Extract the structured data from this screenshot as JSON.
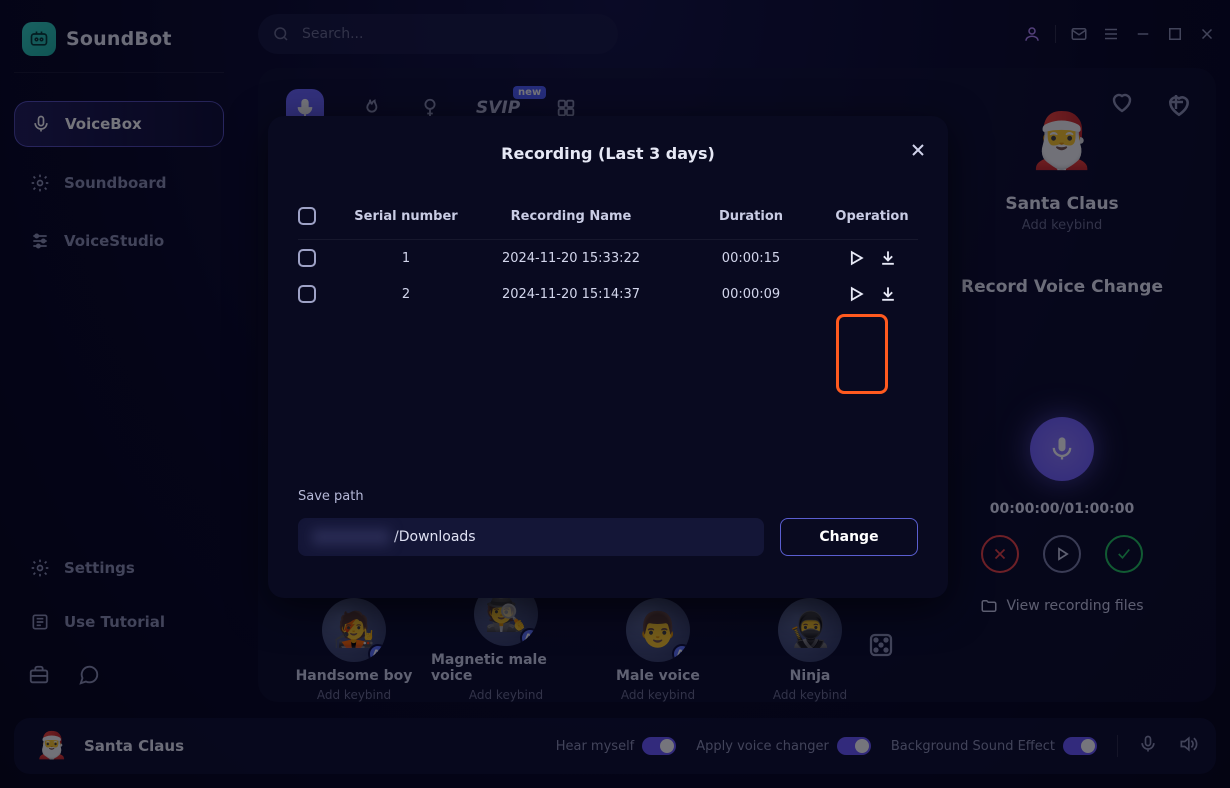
{
  "app": {
    "name": "SoundBot"
  },
  "search": {
    "placeholder": "Search..."
  },
  "sidebar": {
    "items": [
      {
        "label": "VoiceBox"
      },
      {
        "label": "Soundboard"
      },
      {
        "label": "VoiceStudio"
      }
    ],
    "settings_label": "Settings",
    "tutorial_label": "Use Tutorial"
  },
  "tabs": {
    "svip": "SVIP",
    "svip_badge": "new"
  },
  "right": {
    "voice_name": "Santa Claus",
    "voice_sub": "Add keybind",
    "record_label": "Record Voice Change",
    "timer": "00:00:00/01:00:00",
    "view_files": "View recording files"
  },
  "voices": [
    {
      "name": "Handsome boy",
      "sub": "Add keybind",
      "emoji": "🧑‍🎤"
    },
    {
      "name": "Magnetic male voice",
      "sub": "Add keybind",
      "emoji": "🕵️"
    },
    {
      "name": "Male voice",
      "sub": "Add keybind",
      "emoji": "👨"
    },
    {
      "name": "Ninja",
      "sub": "Add keybind",
      "emoji": "🥷"
    }
  ],
  "footer": {
    "voice_name": "Santa Claus",
    "hear": "Hear myself",
    "apply": "Apply voice changer",
    "bse": "Background Sound Effect"
  },
  "modal": {
    "title": "Recording  (Last 3 days)",
    "headers": {
      "serial": "Serial number",
      "name": "Recording Name",
      "duration": "Duration",
      "operation": "Operation"
    },
    "rows": [
      {
        "serial": "1",
        "name": "2024-11-20 15:33:22",
        "duration": "00:00:15"
      },
      {
        "serial": "2",
        "name": "2024-11-20 15:14:37",
        "duration": "00:00:09"
      }
    ],
    "save_path_label": "Save path",
    "save_path_suffix": "/Downloads",
    "change_label": "Change"
  }
}
